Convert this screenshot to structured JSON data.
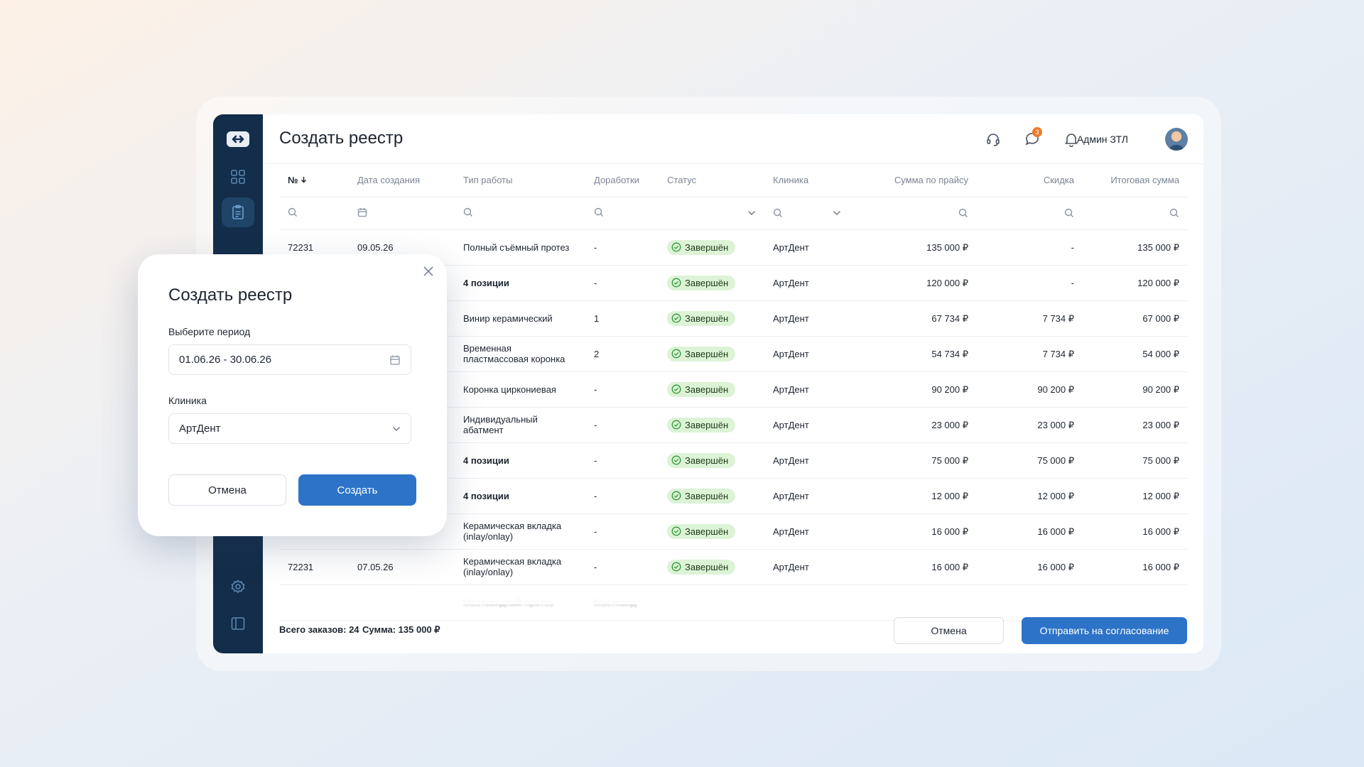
{
  "header": {
    "title": "Создать реестр",
    "notifications_badge": "3",
    "user_name": "Админ ЗТЛ"
  },
  "table": {
    "columns": [
      "№",
      "Дата создания",
      "Тип работы",
      "Доработки",
      "Статус",
      "Клиника",
      "Сумма по прайсу",
      "Скидка",
      "Итоговая сумма"
    ],
    "rows": [
      {
        "num": "72231",
        "date": "09.05.26",
        "work": "Полный съёмный протез",
        "rev": "-",
        "status": "Завершён",
        "clinic": "АртДент",
        "price": "135 000 ₽",
        "discount": "-",
        "total": "135 000 ₽"
      },
      {
        "num": "",
        "date": "",
        "work": "4 позиции",
        "rev": "-",
        "status": "Завершён",
        "clinic": "АртДент",
        "price": "120 000 ₽",
        "discount": "-",
        "total": "120 000 ₽"
      },
      {
        "num": "",
        "date": "",
        "work": "Винир керамический",
        "rev": "1",
        "status": "Завершён",
        "clinic": "АртДент",
        "price": "67 734 ₽",
        "discount": "7 734 ₽",
        "total": "67 000 ₽"
      },
      {
        "num": "",
        "date": "",
        "work": "Временная\nпластмассовая коронка",
        "rev": "2",
        "status": "Завершён",
        "clinic": "АртДент",
        "price": "54 734 ₽",
        "discount": "7 734 ₽",
        "total": "54 000 ₽"
      },
      {
        "num": "",
        "date": "",
        "work": "Коронка циркониевая",
        "rev": "-",
        "status": "Завершён",
        "clinic": "АртДент",
        "price": "90 200 ₽",
        "discount": "90 200 ₽",
        "total": "90 200 ₽"
      },
      {
        "num": "",
        "date": "",
        "work": "Индивидуальный\nабатмент",
        "rev": "-",
        "status": "Завершён",
        "clinic": "АртДент",
        "price": "23 000 ₽",
        "discount": "23 000 ₽",
        "total": "23 000 ₽"
      },
      {
        "num": "",
        "date": "",
        "work": "4 позиции",
        "rev": "-",
        "status": "Завершён",
        "clinic": "АртДент",
        "price": "75 000 ₽",
        "discount": "75 000 ₽",
        "total": "75 000 ₽"
      },
      {
        "num": "",
        "date": "",
        "work": "4 позиции",
        "rev": "-",
        "status": "Завершён",
        "clinic": "АртДент",
        "price": "12 000 ₽",
        "discount": "12 000 ₽",
        "total": "12 000 ₽"
      },
      {
        "num": "",
        "date": "",
        "work": "Керамическая вкладка\n(inlay/onlay)",
        "rev": "-",
        "status": "Завершён",
        "clinic": "АртДент",
        "price": "16 000 ₽",
        "discount": "16 000 ₽",
        "total": "16 000 ₽"
      },
      {
        "num": "72231",
        "date": "07.05.26",
        "work": "Керамическая вкладка\n(inlay/onlay)",
        "rev": "-",
        "status": "Завершён",
        "clinic": "АртДент",
        "price": "16 000 ₽",
        "discount": "16 000 ₽",
        "total": "16 000 ₽"
      },
      {
        "num": "",
        "date": "",
        "work": "Мостовидный протез",
        "rev": "Мостовид",
        "status": "",
        "clinic": "",
        "price": "",
        "discount": "",
        "total": ""
      }
    ]
  },
  "footer": {
    "total_orders": "Всего заказов: 24",
    "sum": "Сумма: 135 000 ₽",
    "cancel": "Отмена",
    "submit": "Отправить на согласование"
  },
  "modal": {
    "title": "Создать реестр",
    "period_label": "Выберите период",
    "period_value": "01.06.26 - 30.06.26",
    "clinic_label": "Клиника",
    "clinic_value": "АртДент",
    "cancel": "Отмена",
    "create": "Создать"
  },
  "colors": {
    "sidebar": "#132d4a",
    "primary": "#2d73c7",
    "status_bg": "#dcf3d6",
    "badge": "#ee7a2e"
  },
  "icons": [
    "logo-icon",
    "dashboard-icon",
    "registry-icon",
    "settings-icon",
    "panel-icon",
    "headset-icon",
    "chat-icon",
    "bell-icon",
    "search-icon",
    "calendar-icon",
    "chevron-down-icon",
    "check-circle-icon",
    "close-icon",
    "sort-down-icon"
  ]
}
